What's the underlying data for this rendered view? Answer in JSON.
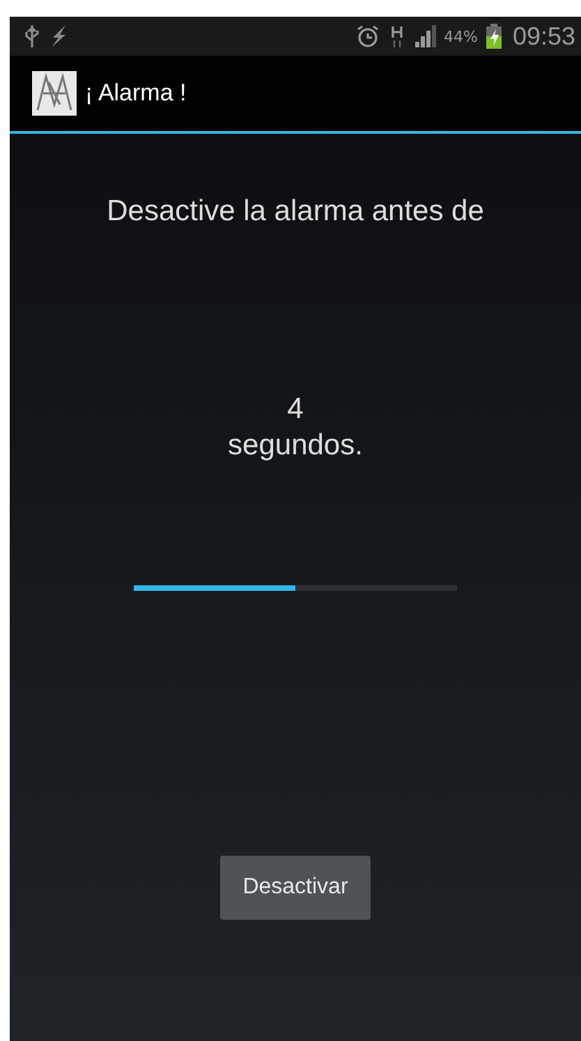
{
  "status_bar": {
    "battery_percent": "44%",
    "time": "09:53"
  },
  "action_bar": {
    "title": "¡ Alarma !"
  },
  "message": "Desactive la alarma antes de",
  "countdown": {
    "value": "4",
    "unit": "segundos."
  },
  "progress": {
    "level": 0.5
  },
  "buttons": [
    {
      "label": "Desactivar"
    }
  ]
}
